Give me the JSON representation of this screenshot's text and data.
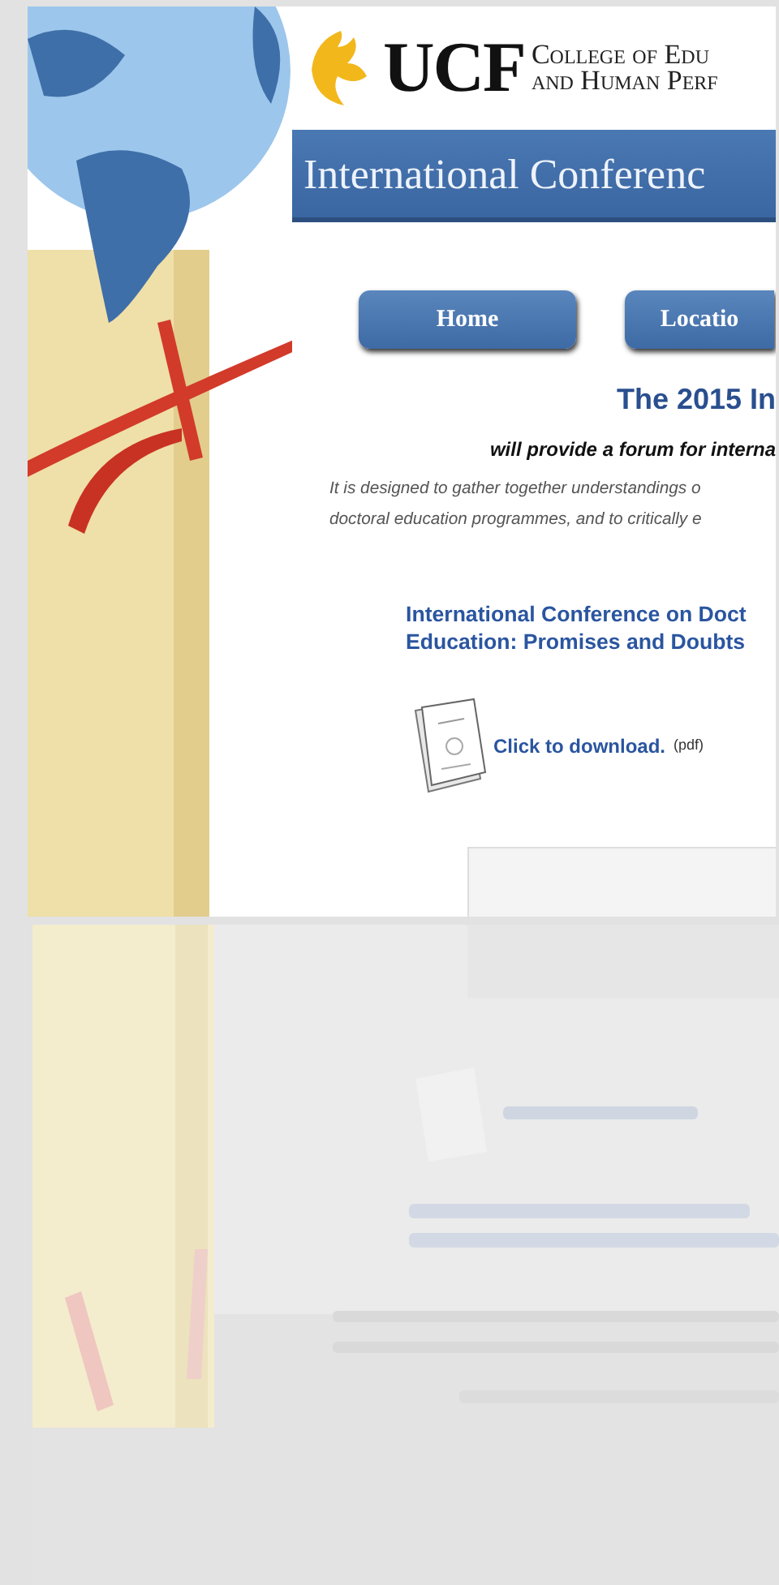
{
  "header": {
    "logo_text": "UCF",
    "college_lines": [
      "College of Edu",
      "and Human Perf"
    ]
  },
  "banner": {
    "title": "International Conferenc"
  },
  "nav": [
    {
      "label": "Home"
    },
    {
      "label": "Locatio"
    }
  ],
  "intro": {
    "heading": "The 2015 In",
    "tagline": "will provide a forum for interna",
    "description_lines": [
      "It is designed to gather together understandings o",
      "doctoral education programmes, and to critically e"
    ]
  },
  "publication": {
    "title_lines": [
      "International Conference on Doct",
      "Education: Promises and Doubts"
    ],
    "download_link": "Click to download.",
    "format": "(pdf)"
  }
}
